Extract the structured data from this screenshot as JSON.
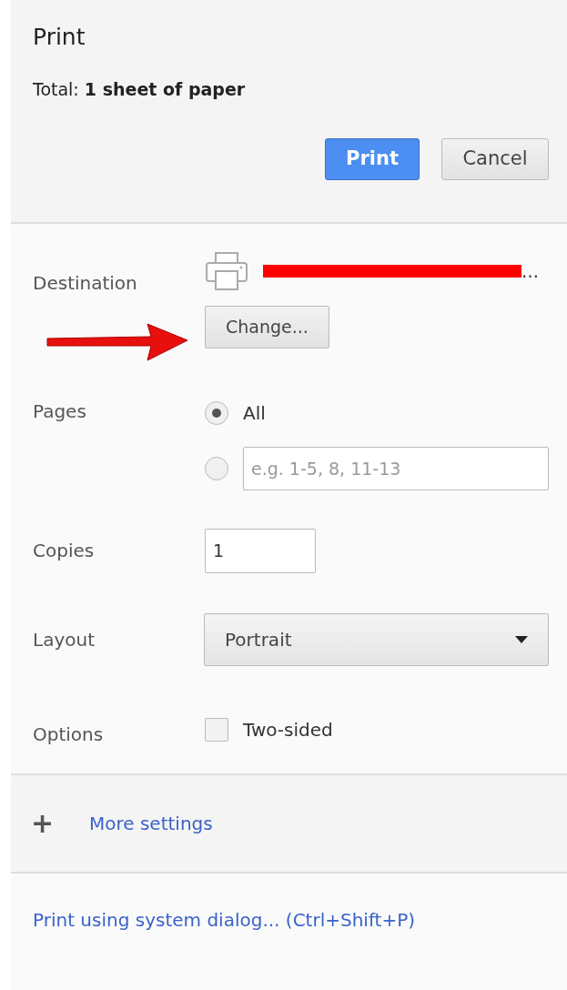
{
  "title": "Print",
  "total": {
    "label": "Total:",
    "value": "1 sheet of paper"
  },
  "buttons": [
    {
      "label": "Print",
      "kind": "primary"
    },
    {
      "label": "Cancel",
      "kind": "secondary"
    }
  ],
  "destination": {
    "label": "Destination",
    "printer_name_visible": "…",
    "redacted": true,
    "change_button": "Change...",
    "annotation_arrow": true
  },
  "pages": {
    "label": "Pages",
    "options": [
      {
        "kind": "all",
        "label": "All",
        "selected": true
      },
      {
        "kind": "custom",
        "placeholder": "e.g. 1-5, 8, 11-13",
        "selected": false
      }
    ]
  },
  "copies": {
    "label": "Copies",
    "value": "1"
  },
  "layout": {
    "label": "Layout",
    "value": "Portrait"
  },
  "options": {
    "label": "Options",
    "items": [
      {
        "label": "Two-sided",
        "checked": false
      }
    ]
  },
  "more_settings": {
    "label": "More settings",
    "icon": "+"
  },
  "system_dialog_link": "Print using system dialog... (Ctrl+Shift+P)"
}
